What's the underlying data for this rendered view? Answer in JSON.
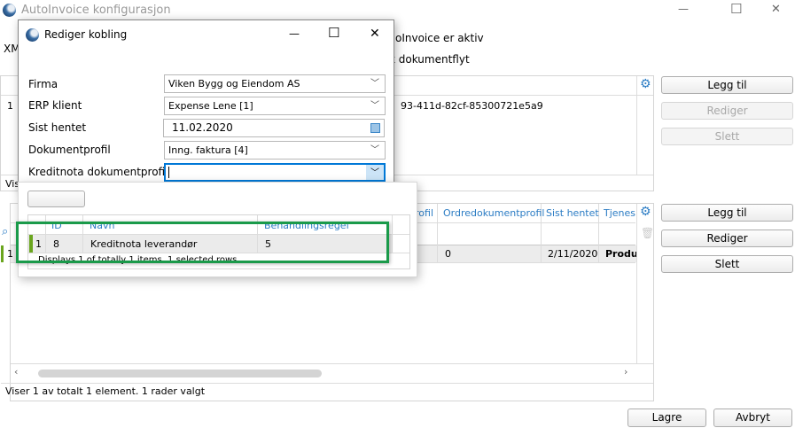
{
  "main_window": {
    "title": "AutoInvoice konfigurasjon",
    "minimize": "—",
    "maximize": "☐",
    "close": "✕",
    "xml_label_partial": "XM",
    "active_label_partial": "oInvoice er aktiv",
    "flow_label_partial": "k dokumentflyt"
  },
  "upper_grid": {
    "row_number": "1",
    "row_value_partial": "93-411d-82cf-85300721e5a9",
    "status_partial": "Vis",
    "buttons": {
      "add": "Legg til",
      "edit": "Rediger",
      "delete": "Slett"
    }
  },
  "lower_grid": {
    "columns": [
      "rofil",
      "Ordredokumentprofil",
      "Sist hentet",
      "Tjeneste"
    ],
    "row": {
      "number": "1",
      "ordredokumentprofil": "0",
      "sist_hentet": "2/11/2020",
      "tjeneste": "Produc"
    },
    "status": "Viser 1 av totalt 1 element. 1 rader valgt",
    "buttons": {
      "add": "Legg til",
      "edit": "Rediger",
      "delete": "Slett"
    }
  },
  "footer": {
    "save": "Lagre",
    "cancel": "Avbryt"
  },
  "dialog": {
    "title": "Rediger kobling",
    "minimize": "—",
    "maximize": "☐",
    "close": "✕",
    "fields": [
      {
        "label": "Firma",
        "value": "Viken Bygg og Eiendom AS"
      },
      {
        "label": "ERP klient",
        "value": "Expense Lene [1]"
      },
      {
        "label": "Sist hentet",
        "value": "11.02.2020"
      },
      {
        "label": "Dokumentprofil",
        "value": "Inng. faktura [4]"
      },
      {
        "label": "Kreditnota dokumentprofil",
        "value": ""
      }
    ]
  },
  "dropdown": {
    "button_label": "",
    "columns": [
      "ID",
      "Navn",
      "Behandlingsregel"
    ],
    "rows": [
      {
        "number": "1",
        "id": "8",
        "navn": "Kreditnota leverandør",
        "behandlingsregel": "5"
      }
    ],
    "status": "Displays 1 of totally 1 items. 1 selected rows"
  },
  "colors": {
    "accent": "#2b7cc4",
    "highlight": "#1a9a4a",
    "row_indicator": "#6aa51e"
  }
}
